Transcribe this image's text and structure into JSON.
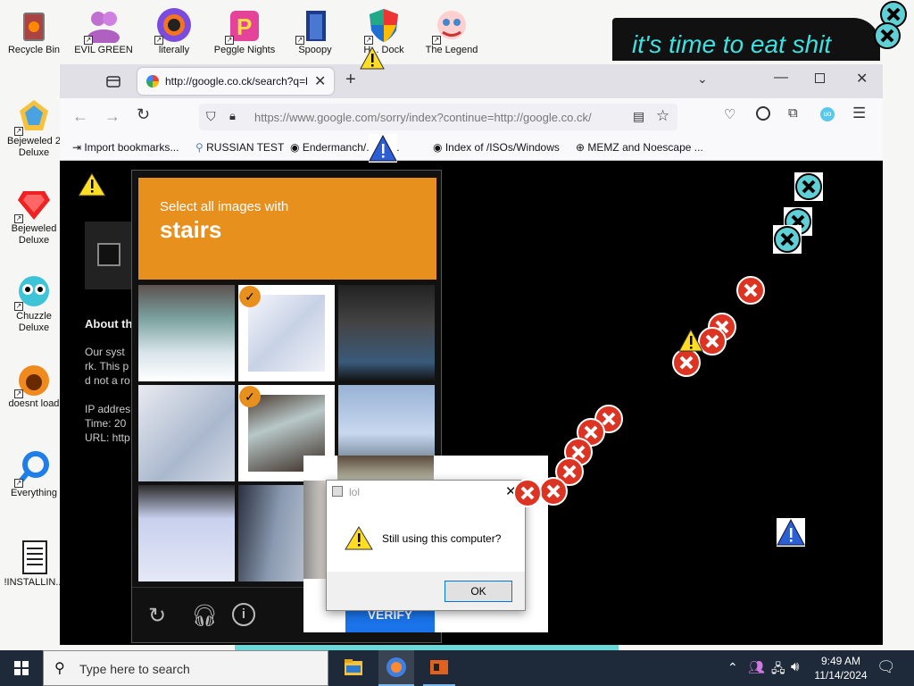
{
  "desktop": {
    "banner_text": "it's time to eat shit",
    "icons": [
      {
        "name": "recycle-bin",
        "label": "Recycle Bin"
      },
      {
        "name": "evil-green",
        "label": "EVIL GREEN"
      },
      {
        "name": "literally",
        "label": "literally"
      },
      {
        "name": "peggle-nights",
        "label": "Peggle Nights"
      },
      {
        "name": "spoopy",
        "label": "Spoopy"
      },
      {
        "name": "hdock",
        "label": "H... Dock"
      },
      {
        "name": "the-legend",
        "label": "The Legend"
      },
      {
        "name": "bejeweled-2",
        "label": "Bejeweled 2 Deluxe"
      },
      {
        "name": "bejeweled",
        "label": "Bejeweled Deluxe"
      },
      {
        "name": "chuzzle",
        "label": "Chuzzle Deluxe"
      },
      {
        "name": "doesnt-load",
        "label": "doesnt load"
      },
      {
        "name": "everything",
        "label": "Everything"
      },
      {
        "name": "installin",
        "label": "!INSTALLIN..."
      }
    ]
  },
  "browser": {
    "tab_title": "http://google.co.ck/search?q=lc",
    "url": "https://www.google.com/sorry/index?continue=http://google.co.ck/",
    "bookmarks": [
      "Import bookmarks...",
      "RUSSIAN TEST",
      "Endermanch/...are...",
      "Index of /ISOs/Windows",
      "MEMZ and Noescape ..."
    ]
  },
  "page": {
    "about_heading": "About th",
    "body_lines": [
      "Our syst",
      "rk. This p",
      "d not a ro"
    ],
    "ip_lines": [
      "IP addres",
      "Time: 20",
      "URL: http"
    ]
  },
  "captcha": {
    "prompt": "Select all images with",
    "keyword": "stairs",
    "verify_label": "VERIFY"
  },
  "dialog": {
    "title": "lol",
    "message": "Still using this computer?",
    "ok_label": "OK"
  },
  "taskbar": {
    "search_placeholder": "Type here to search",
    "time": "9:49 AM",
    "date": "11/14/2024"
  },
  "colors": {
    "captcha_orange": "#e8901e",
    "verify_blue": "#1a73e8",
    "taskbar": "#1e2a3a"
  }
}
